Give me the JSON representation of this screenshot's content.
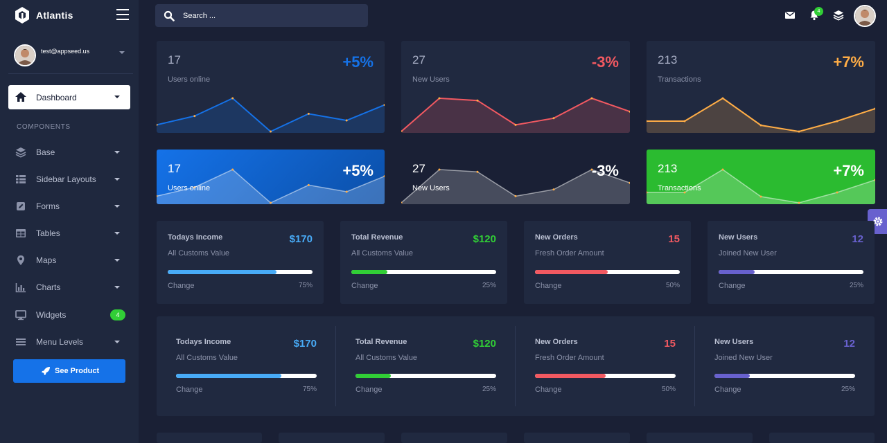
{
  "app": {
    "name": "Atlantis"
  },
  "user": {
    "email": "test@appseed.us"
  },
  "sidebar": {
    "dashboard_label": "Dashboard",
    "section_heading": "COMPONENTS",
    "items": [
      {
        "label": "Base",
        "icon": "layers-icon"
      },
      {
        "label": "Sidebar Layouts",
        "icon": "th-list-icon"
      },
      {
        "label": "Forms",
        "icon": "pen-square-icon"
      },
      {
        "label": "Tables",
        "icon": "table-icon"
      },
      {
        "label": "Maps",
        "icon": "map-marker-icon"
      },
      {
        "label": "Charts",
        "icon": "bar-chart-icon"
      },
      {
        "label": "Widgets",
        "icon": "desktop-icon",
        "badge": "4"
      },
      {
        "label": "Menu Levels",
        "icon": "bars-icon"
      }
    ],
    "cta_label": "See Product"
  },
  "topbar": {
    "search_placeholder": "Search ...",
    "notification_count": "4"
  },
  "stat_cards": [
    {
      "value": "17",
      "label": "Users online",
      "change": "+5%",
      "color": "#1572e8",
      "series": [
        3,
        7,
        15,
        0,
        8,
        5,
        12
      ]
    },
    {
      "value": "27",
      "label": "New Users",
      "change": "-3%",
      "color": "#f25961",
      "series": [
        0,
        15,
        14,
        3,
        6,
        15,
        9
      ]
    },
    {
      "value": "213",
      "label": "Transactions",
      "change": "+7%",
      "color": "#ffad46",
      "series": [
        5,
        5,
        16,
        3,
        0,
        5,
        11
      ]
    }
  ],
  "filled_cards": [
    {
      "value": "17",
      "label": "Users online",
      "change": "+5%",
      "bg": "#1572e8",
      "series": [
        3,
        7,
        15,
        0,
        8,
        5,
        12
      ]
    },
    {
      "value": "27",
      "label": "New Users",
      "change": "-3%",
      "bg": "#1a2035",
      "series": [
        0,
        15,
        14,
        3,
        6,
        15,
        9
      ]
    },
    {
      "value": "213",
      "label": "Transactions",
      "change": "+7%",
      "bg": "#2bbb30",
      "series": [
        5,
        5,
        16,
        3,
        0,
        5,
        11
      ]
    }
  ],
  "kpis": [
    {
      "title": "Todays Income",
      "subtitle": "All Customs Value",
      "value": "$170",
      "value_color": "#48abf7",
      "bar_color": "#48abf7",
      "progress": 0.75,
      "foot": "Change",
      "pct": "75%"
    },
    {
      "title": "Total Revenue",
      "subtitle": "All Customs Value",
      "value": "$120",
      "value_color": "#31ce36",
      "bar_color": "#31ce36",
      "progress": 0.25,
      "foot": "Change",
      "pct": "25%"
    },
    {
      "title": "New Orders",
      "subtitle": "Fresh Order Amount",
      "value": "15",
      "value_color": "#f25961",
      "bar_color": "#f25961",
      "progress": 0.5,
      "foot": "Change",
      "pct": "50%"
    },
    {
      "title": "New Users",
      "subtitle": "Joined New User",
      "value": "12",
      "value_color": "#6861ce",
      "bar_color": "#6861ce",
      "progress": 0.25,
      "foot": "Change",
      "pct": "25%"
    }
  ]
}
